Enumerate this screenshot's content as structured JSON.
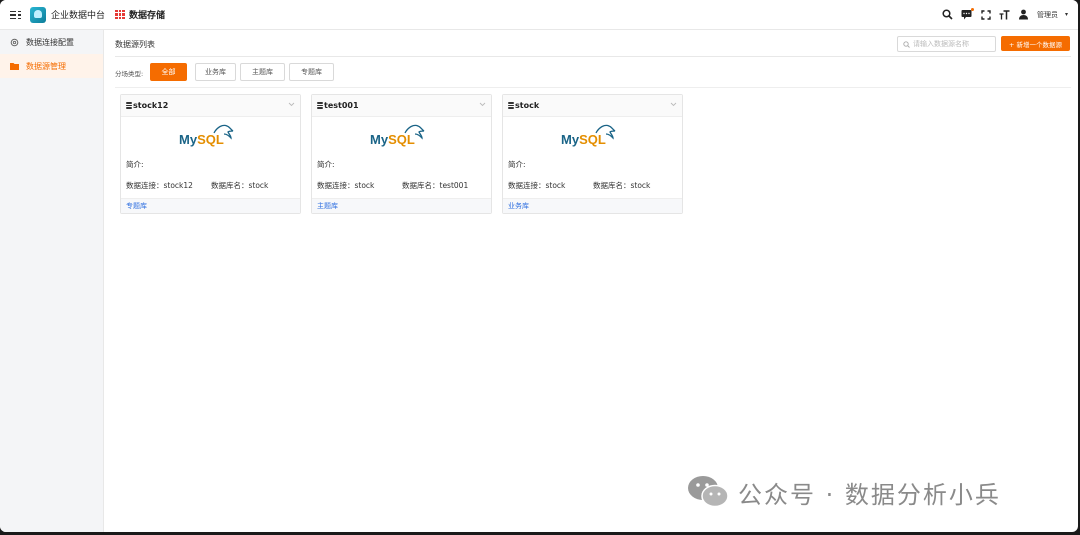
{
  "header": {
    "app_title": "企业数据中台",
    "module_title": "数据存储",
    "user_name": "管理员"
  },
  "sidebar": {
    "items": [
      {
        "label": "数据连接配置",
        "icon": "settings-icon",
        "active": false
      },
      {
        "label": "数据源管理",
        "icon": "folder-icon",
        "active": true
      }
    ]
  },
  "main": {
    "list_title": "数据源列表",
    "search_placeholder": "请输入数据源名称",
    "add_button": "+ 新增一个数据源",
    "filter_label": "分场类型:",
    "filters": [
      "全部",
      "业务库",
      "主题库",
      "专题库"
    ],
    "active_filter": "全部"
  },
  "cards": [
    {
      "name": "stock12",
      "desc": "简介:",
      "conn": "数据连接：stock12",
      "dbname": "数据库名：stock",
      "tag": "专题库",
      "logo_text": "MySQL"
    },
    {
      "name": "test001",
      "desc": "简介:",
      "conn": "数据连接：stock",
      "dbname": "数据库名：test001",
      "tag": "主题库",
      "logo_text": "MySQL"
    },
    {
      "name": "stock",
      "desc": "简介:",
      "conn": "数据连接：stock",
      "dbname": "数据库名：stock",
      "tag": "业务库",
      "logo_text": "MySQL"
    }
  ],
  "watermark": "公众号 · 数据分析小兵",
  "colors": {
    "accent": "#f56c00",
    "link": "#2f6fe0",
    "mysql_blue": "#1a6487",
    "mysql_orange": "#e48e00"
  }
}
